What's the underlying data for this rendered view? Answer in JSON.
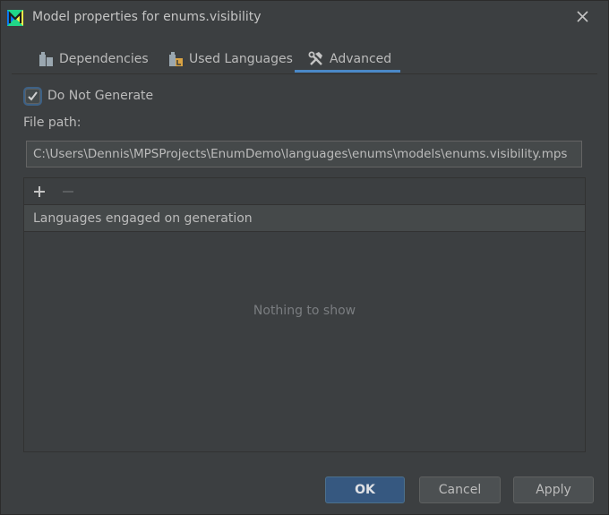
{
  "window": {
    "title": "Model properties for enums.visibility"
  },
  "icons": {
    "app": "mps-logo-icon",
    "close": "close-icon",
    "dependencies": "dependencies-icon",
    "languages": "used-languages-icon",
    "advanced": "wrench-hammer-icon",
    "checkmark": "checkmark-icon",
    "add": "plus-icon",
    "remove": "minus-icon"
  },
  "tabs": [
    {
      "label": "Dependencies",
      "active": false
    },
    {
      "label": "Used Languages",
      "active": false
    },
    {
      "label": "Advanced",
      "active": true
    }
  ],
  "advanced": {
    "do_not_generate": {
      "label": "Do Not Generate",
      "checked": true
    },
    "file_path_label": "File path:",
    "file_path_value": "C:\\Users\\Dennis\\MPSProjects\\EnumDemo\\languages\\enums\\models\\enums.visibility.mps",
    "table": {
      "header": "Languages engaged on generation",
      "empty_text": "Nothing to show",
      "rows": []
    }
  },
  "buttons": {
    "ok": "OK",
    "cancel": "Cancel",
    "apply": "Apply"
  },
  "colors": {
    "background": "#3c3f41",
    "accent": "#4a88c7",
    "primary_button": "#365880"
  }
}
